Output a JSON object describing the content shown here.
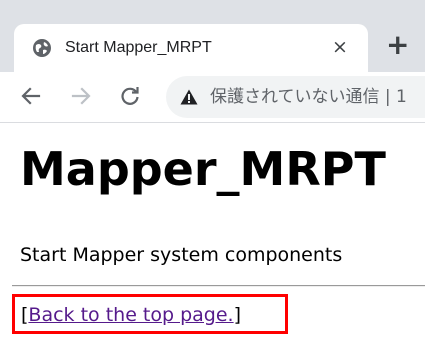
{
  "browser": {
    "tab": {
      "title": "Start Mapper_MRPT",
      "favicon_icon": "globe-icon",
      "close_label": "×"
    },
    "new_tab_label": "+",
    "toolbar": {
      "back_icon": "arrow-left-icon",
      "forward_icon": "arrow-right-icon",
      "reload_icon": "reload-icon",
      "security_icon": "warning-triangle-icon",
      "address_text": "保護されていない通信 | 1"
    }
  },
  "page": {
    "heading": "Mapper_MRPT",
    "description": "Start Mapper system components",
    "back_link": {
      "open_bracket": "[",
      "label": "Back to the top page.",
      "close_bracket": "]"
    }
  },
  "colors": {
    "tab_strip": "#dee1e6",
    "omnibox": "#f1f3f4",
    "visited_link": "#551a8b",
    "highlight_border": "#ff0000"
  }
}
